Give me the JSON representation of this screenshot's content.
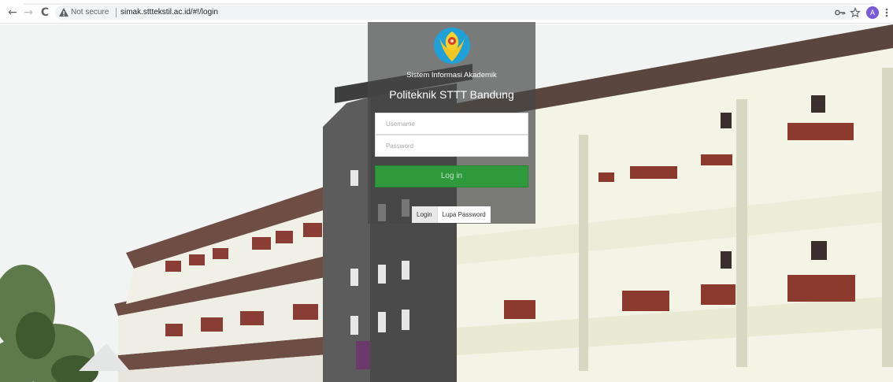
{
  "browser": {
    "nav": {
      "back": "←",
      "forward": "→",
      "reload": "C"
    },
    "security_label": "Not secure",
    "url": "simak.stttekstil.ac.id/#!/login",
    "icons": {
      "key": "key-icon",
      "star": "star-icon",
      "menu": "kebab-menu-icon"
    },
    "avatar_initial": "A",
    "avatar_color": "#7b5ad6"
  },
  "login": {
    "subtitle": "Sistem Informasi Akademik",
    "title": "Politeknik STTT Bandung",
    "username_placeholder": "Username",
    "password_placeholder": "Password",
    "submit_label": "Log in",
    "submit_color": "#2e9a3c",
    "tabs": [
      {
        "label": "Login",
        "active": true
      },
      {
        "label": "Lupa Password",
        "active": false
      }
    ]
  }
}
